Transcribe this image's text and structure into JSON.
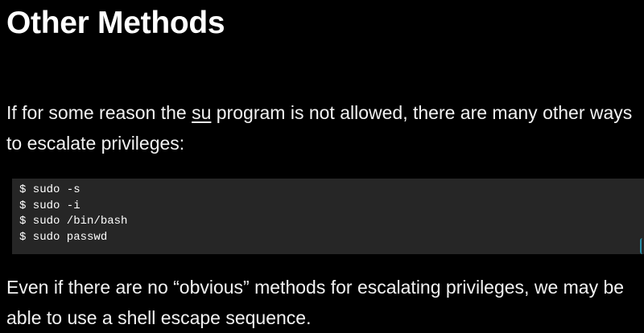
{
  "slide": {
    "title": "Other Methods",
    "intro": {
      "before": "If for some reason the ",
      "program": "su",
      "after": " program is not allowed, there are many other ways to escalate privileges:"
    },
    "commands": [
      "$ sudo -s",
      "$ sudo -i",
      "$ sudo /bin/bash",
      "$ sudo passwd"
    ],
    "closing": "Even if there are no “obvious” methods for escalating privileges, we may be able to use a shell escape sequence."
  }
}
